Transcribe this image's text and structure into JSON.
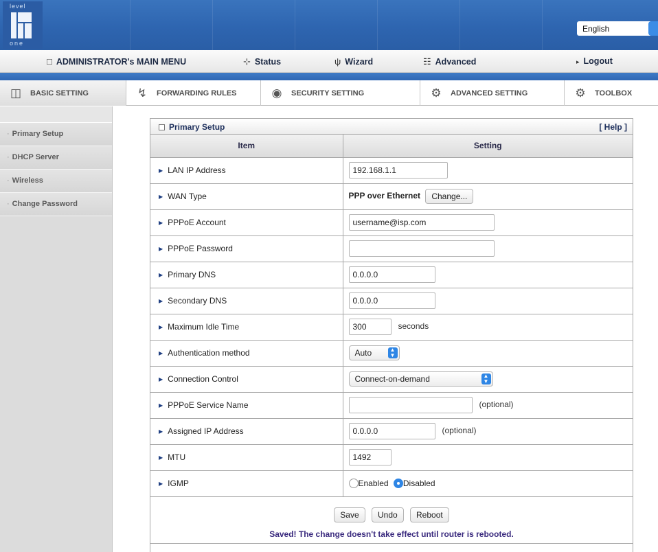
{
  "logo": {
    "top_text": "level",
    "bottom_text": "one"
  },
  "language": {
    "selected": "English"
  },
  "main_menu": {
    "admin": "ADMINISTRATOR's MAIN MENU",
    "status": "Status",
    "wizard": "Wizard",
    "advanced": "Advanced",
    "logout": "Logout"
  },
  "tabs": [
    {
      "label": "BASIC SETTING",
      "icon": "folder-icon"
    },
    {
      "label": "FORWARDING RULES",
      "icon": "arrow-icon"
    },
    {
      "label": "SECURITY SETTING",
      "icon": "lock-icon"
    },
    {
      "label": "ADVANCED SETTING",
      "icon": "gear-icon"
    },
    {
      "label": "TOOLBOX",
      "icon": "toolbox-icon"
    }
  ],
  "sidebar": {
    "items": [
      {
        "label": "Primary Setup"
      },
      {
        "label": "DHCP Server"
      },
      {
        "label": "Wireless"
      },
      {
        "label": "Change Password"
      }
    ]
  },
  "panel": {
    "title": "Primary Setup",
    "help": "[ Help ]",
    "col_item": "Item",
    "col_setting": "Setting",
    "rows": {
      "lan_ip": {
        "label": "LAN IP Address",
        "value": "192.168.1.1"
      },
      "wan_type": {
        "label": "WAN Type",
        "value": "PPP over Ethernet",
        "button": "Change..."
      },
      "pppoe_account": {
        "label": "PPPoE Account",
        "value": "username@isp.com"
      },
      "pppoe_password": {
        "label": "PPPoE Password",
        "value": ""
      },
      "primary_dns": {
        "label": "Primary DNS",
        "value": "0.0.0.0"
      },
      "secondary_dns": {
        "label": "Secondary DNS",
        "value": "0.0.0.0"
      },
      "idle_time": {
        "label": "Maximum Idle Time",
        "value": "300",
        "unit": "seconds"
      },
      "auth": {
        "label": "Authentication method",
        "value": "Auto"
      },
      "conn": {
        "label": "Connection Control",
        "value": "Connect-on-demand"
      },
      "service": {
        "label": "PPPoE Service Name",
        "value": "",
        "note": "(optional)"
      },
      "assigned_ip": {
        "label": "Assigned IP Address",
        "value": "0.0.0.0",
        "note": "(optional)"
      },
      "mtu": {
        "label": "MTU",
        "value": "1492"
      },
      "igmp": {
        "label": "IGMP",
        "enabled": "Enabled",
        "disabled": "Disabled",
        "selected": "Disabled"
      }
    },
    "buttons": {
      "save": "Save",
      "undo": "Undo",
      "reboot": "Reboot"
    },
    "message": "Saved! The change doesn't take effect until router is rebooted."
  }
}
